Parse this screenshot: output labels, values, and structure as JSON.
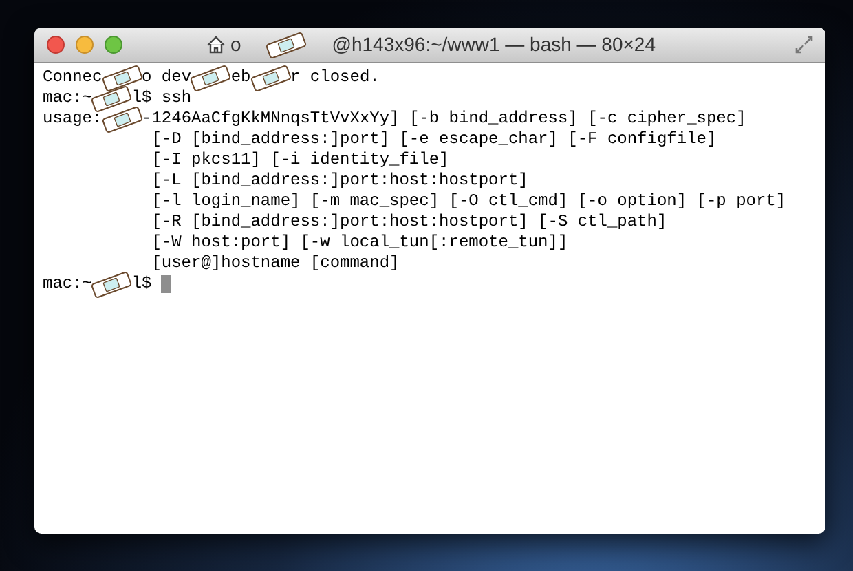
{
  "window": {
    "title_parts": [
      "o",
      "@h143x96:~/www1 — bash — 80×24"
    ]
  },
  "terminal": {
    "lines": [
      {
        "kind": "plain",
        "parts": [
          "Connec",
          "o dev",
          "eb",
          "r closed."
        ]
      },
      {
        "kind": "plain",
        "parts": [
          "mac:~",
          "l$ ssh"
        ]
      },
      {
        "kind": "plain",
        "parts": [
          "usage:",
          "-1246AaCfgKkMNnqsTtVvXxYy] [-b bind_address] [-c cipher_spec]"
        ]
      },
      {
        "kind": "indent",
        "parts": [
          "[-D [bind_address:]port] [-e escape_char] [-F configfile]"
        ]
      },
      {
        "kind": "indent",
        "parts": [
          "[-I pkcs11] [-i identity_file]"
        ]
      },
      {
        "kind": "indent",
        "parts": [
          "[-L [bind_address:]port:host:hostport]"
        ]
      },
      {
        "kind": "indent",
        "parts": [
          "[-l login_name] [-m mac_spec] [-O ctl_cmd] [-o option] [-p port]"
        ]
      },
      {
        "kind": "indent",
        "parts": [
          "[-R [bind_address:]port:host:hostport] [-S ctl_path]"
        ]
      },
      {
        "kind": "indent",
        "parts": [
          "[-W host:port] [-w local_tun[:remote_tun]]"
        ]
      },
      {
        "kind": "indent",
        "parts": [
          "[user@]hostname [command]"
        ]
      },
      {
        "kind": "prompt",
        "parts": [
          "mac:~",
          "l$"
        ]
      }
    ]
  }
}
